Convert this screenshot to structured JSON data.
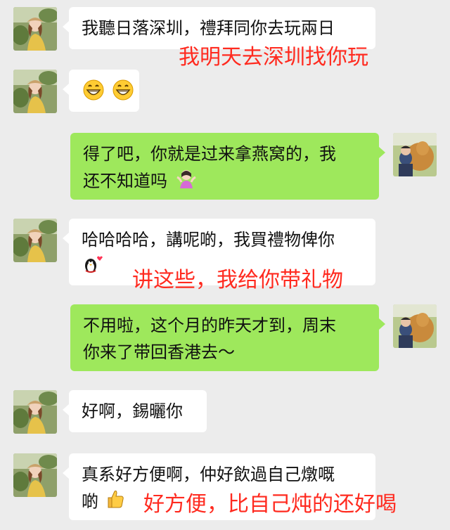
{
  "messages": [
    {
      "lines": [
        "我聽日落深圳，禮拜同你去玩兩日"
      ]
    },
    {
      "lines": [
        ""
      ],
      "emoji": [
        "grinning-face-emoji",
        "grinning-face-emoji"
      ]
    },
    {
      "lines": [
        "得了吧，你就是过来拿燕窝的，我",
        "还不知道吗"
      ],
      "emoji": [
        "shrugging-woman-emoji"
      ]
    },
    {
      "lines": [
        "哈哈哈哈，講呢啲，我買禮物俾你",
        ""
      ],
      "emoji": [
        "penguin-kiss-emoji"
      ]
    },
    {
      "lines": [
        "不用啦，这个月的昨天才到，周末",
        "你来了带回香港去～"
      ]
    },
    {
      "lines": [
        "好啊，錫曬你"
      ]
    },
    {
      "lines": [
        "真系好方便啊，仲好飲過自己燉嘅",
        "啲"
      ],
      "emoji": [
        "thumbs-up-emoji"
      ]
    }
  ],
  "translations": [
    "我明天去深圳找你玩",
    "讲这些，我给你带礼物",
    "好方便，比自己炖的还好喝"
  ],
  "colors": {
    "background": "#ececec",
    "left_bubble": "#ffffff",
    "right_bubble": "#9ee85c",
    "translation": "#ff2a1f"
  }
}
